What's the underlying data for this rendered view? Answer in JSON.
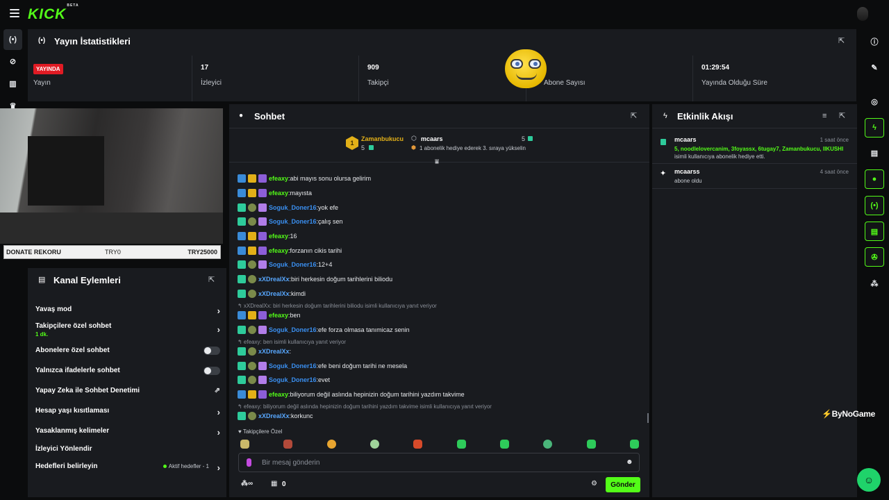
{
  "brand": {
    "logo": "KICK",
    "logo_badge": "BETA",
    "corner_watermark": "ByNoGame"
  },
  "stats": {
    "title": "Yayın İstatistikleri",
    "live_badge": "YAYINDA",
    "cells": [
      {
        "value": "",
        "label": "Yayın"
      },
      {
        "value": "17",
        "label": "İzleyici"
      },
      {
        "value": "909",
        "label": "Takipçi"
      },
      {
        "value": "",
        "label": "Abone Sayısı"
      },
      {
        "value": "01:29:54",
        "label": "Yayında Olduğu Süre"
      }
    ]
  },
  "donate": {
    "label": "DONATE REKORU",
    "from": "TRY0",
    "to": "TRY25000"
  },
  "channel_actions": {
    "title": "Kanal Eylemleri",
    "rows": [
      {
        "label": "Yavaş mod",
        "control": "chevron"
      },
      {
        "label": "Takipçilere özel sohbet",
        "sub": "1 dk.",
        "control": "chevron"
      },
      {
        "label": "Abonelere özel sohbet",
        "control": "toggle",
        "on": false
      },
      {
        "label": "Yalnızca ifadelerle sohbet",
        "control": "toggle",
        "on": false
      },
      {
        "label": "Yapay Zeka ile Sohbet Denetimi",
        "control": "external"
      },
      {
        "label": "Hesap yaşı kısıtlaması",
        "control": "chevron"
      },
      {
        "label": "Yasaklanmış kelimeler",
        "control": "chevron"
      },
      {
        "label": "İzleyici Yönlendir",
        "control": "none"
      },
      {
        "label": "Hedefleri belirleyin",
        "status": "Aktif hedefler - 1",
        "control": "chevron"
      }
    ]
  },
  "chat": {
    "title": "Sohbet",
    "leaderboard": {
      "first": {
        "rank": "1",
        "name": "Zamanbukucu",
        "count": "5"
      },
      "second": {
        "name": "mcaars",
        "count": "5",
        "note": "1 abonelik hediye ederek 3. sıraya yükselin"
      }
    },
    "messages": [
      {
        "user": "efeaxy",
        "color": "green",
        "text": "abi mayıs sonu olursa gelirim"
      },
      {
        "user": "efeaxy",
        "color": "green",
        "text": "mayısta"
      },
      {
        "user": "Soguk_Doner16",
        "color": "blue",
        "text": "yok efe"
      },
      {
        "user": "Soguk_Doner16",
        "color": "blue",
        "text": "çalış sen"
      },
      {
        "user": "efeaxy",
        "color": "green",
        "text": "16"
      },
      {
        "user": "efeaxy",
        "color": "green",
        "text": "forzanın cikis tarihi"
      },
      {
        "user": "Soguk_Doner16",
        "color": "blue",
        "text": "12+4"
      },
      {
        "user": "xXDrealXx",
        "color": "lblue",
        "text": "biri herkesin doğum tarihlerini biliodu"
      },
      {
        "user": "xXDrealXx",
        "color": "lblue",
        "text": "kimdi"
      },
      {
        "reply": "xXDrealXx: biri herkesin doğum tarihlerini biliodu isimli kullanıcıya yanıt veriyor"
      },
      {
        "user": "efeaxy",
        "color": "green",
        "text": "ben"
      },
      {
        "user": "Soguk_Doner16",
        "color": "blue",
        "text": "efe forza olmasa tanımicaz senin"
      },
      {
        "reply": "efeaxy: ben   isimli kullanıcıya yanıt veriyor"
      },
      {
        "user": "xXDrealXx",
        "color": "lblue",
        "text": ""
      },
      {
        "user": "Soguk_Doner16",
        "color": "blue",
        "text": "efe beni doğum tarihi ne mesela"
      },
      {
        "user": "Soguk_Doner16",
        "color": "blue",
        "text": "evet"
      },
      {
        "user": "efeaxy",
        "color": "green",
        "text": "biliyorum değil aslında hepinizin doğum tarihini yazdım takvime"
      },
      {
        "reply": "efeaxy: biliyorum değil aslında hepinizin doğum tarihini yazdım takvime isimli kullanıcıya yanıt veriyor"
      },
      {
        "user": "xXDrealXx",
        "color": "lblue",
        "text": "korkunc"
      }
    ],
    "emote_section": "Takipçilere Özel",
    "input_placeholder": "Bir mesaj gönderin",
    "footer_count": "0",
    "send": "Gönder"
  },
  "activity": {
    "title": "Etkinlik Akışı",
    "events": [
      {
        "name": "mcaars",
        "time": "1 saat önce",
        "highlight": "5, noodlelovercanim, 3foyassx, 6tugay7, Zamanbukucu, IIKUSHI",
        "detail": "isimli kullanıcıya abonelik hediye etti."
      },
      {
        "name": "mcaarss",
        "time": "4 saat önce",
        "detail": "abone oldu"
      }
    ]
  },
  "colors": {
    "accent": "#53fc18",
    "panel": "#191b1f",
    "bg": "#0b0c0d",
    "live": "#e01b24"
  }
}
